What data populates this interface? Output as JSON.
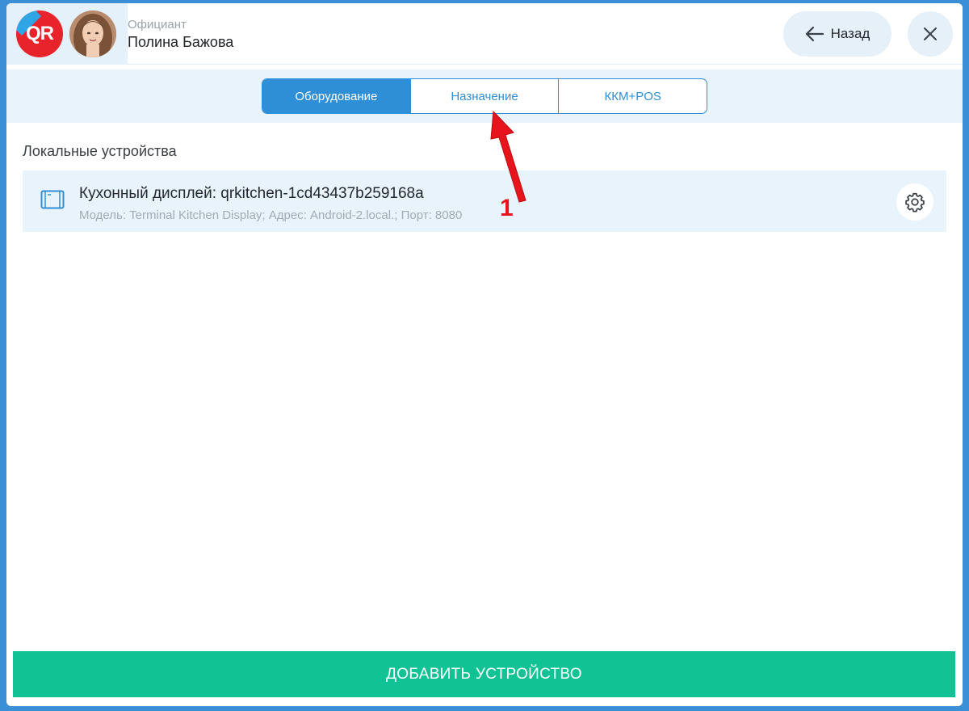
{
  "header": {
    "logo_text": "QR",
    "role": "Официант",
    "user_name": "Полина Бажова",
    "back_label": "Назад"
  },
  "tabs": [
    {
      "label": "Оборудование",
      "active": true
    },
    {
      "label": "Назначение",
      "active": false
    },
    {
      "label": "ККМ+POS",
      "active": false
    }
  ],
  "main": {
    "section_title": "Локальные устройства",
    "devices": [
      {
        "name": "Кухонный дисплей: qrkitchen-1cd43437b259168a",
        "meta": "Модель: Terminal Kitchen Display; Адрес: Android-2.local.; Порт: 8080",
        "icon": "tablet-icon"
      }
    ]
  },
  "annotation": {
    "number": "1",
    "color": "#e8141c"
  },
  "footer": {
    "add_device_label": "ДОБАВИТЬ УСТРОЙСТВО"
  },
  "colors": {
    "accent": "#2e8fd6",
    "success": "#11c295",
    "frame": "#3a8fd6"
  }
}
